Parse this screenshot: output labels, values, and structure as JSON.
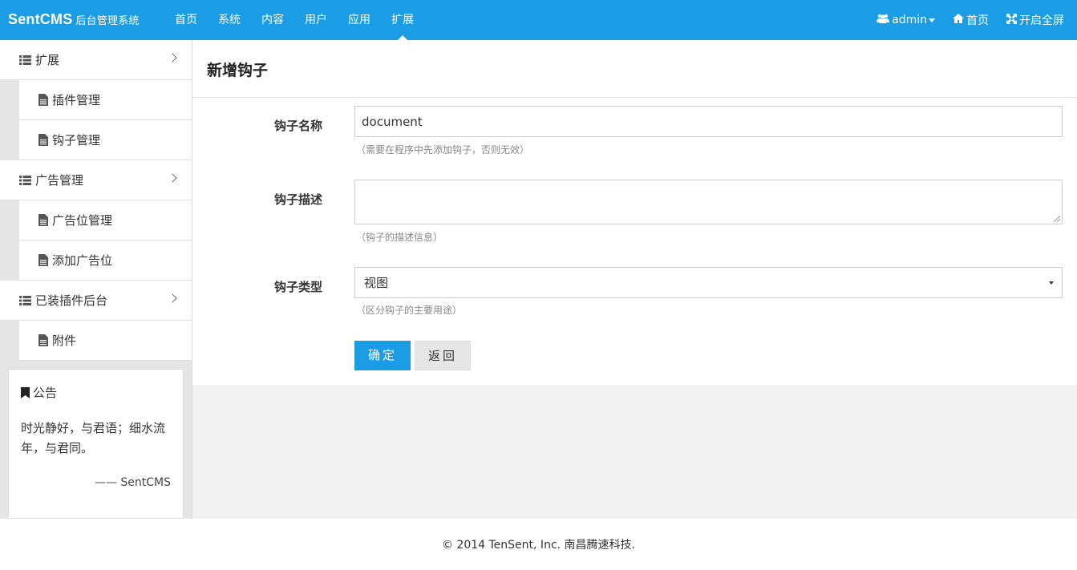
{
  "header": {
    "brand": "SentCMS",
    "brand_sub": "后台管理系统",
    "nav": [
      "首页",
      "系统",
      "内容",
      "用户",
      "应用",
      "扩展"
    ],
    "active_nav": "扩展",
    "user_label": "admin",
    "home_label": "首页",
    "fullscreen_label": "开启全屏"
  },
  "sidebar": {
    "groups": [
      {
        "label": "扩展",
        "items": [
          "插件管理",
          "钩子管理"
        ]
      },
      {
        "label": "广告管理",
        "items": [
          "广告位管理",
          "添加广告位"
        ]
      },
      {
        "label": "已装插件后台",
        "items": [
          "附件"
        ]
      }
    ],
    "notice": {
      "title": "公告",
      "body": "时光静好，与君语；细水流年，与君同。",
      "sign": "—— SentCMS"
    }
  },
  "main": {
    "title": "新增钩子",
    "fields": {
      "name": {
        "label": "钩子名称",
        "value": "document",
        "help": "（需要在程序中先添加钩子，否则无效）"
      },
      "desc": {
        "label": "钩子描述",
        "value": "",
        "help": "（钩子的描述信息）"
      },
      "type": {
        "label": "钩子类型",
        "value": "视图",
        "help": "（区分钩子的主要用途）"
      }
    },
    "buttons": {
      "submit": "确定",
      "back": "返回"
    }
  },
  "footer": {
    "text": "© 2014 TenSent, Inc. 南昌腾速科技."
  },
  "colors": {
    "accent": "#1a9de5",
    "sidebar_bg": "#e5e5e5"
  }
}
